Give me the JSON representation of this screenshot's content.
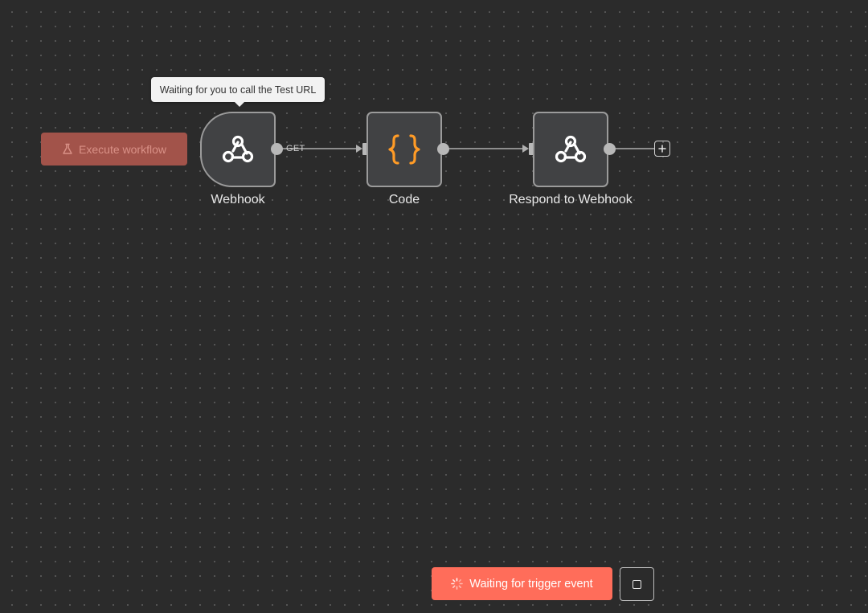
{
  "toolbar": {
    "execute_label": "Execute workflow"
  },
  "tooltip": {
    "text": "Waiting for you to call the Test URL"
  },
  "nodes": [
    {
      "id": "webhook",
      "label": "Webhook",
      "icon": "webhook-icon"
    },
    {
      "id": "code",
      "label": "Code",
      "icon": "code-braces-icon"
    },
    {
      "id": "respond",
      "label": "Respond to Webhook",
      "icon": "webhook-icon"
    }
  ],
  "connections": [
    {
      "from": "webhook",
      "to": "code",
      "label": "GET"
    },
    {
      "from": "code",
      "to": "respond",
      "label": ""
    }
  ],
  "footer": {
    "waiting_label": "Waiting for trigger event"
  },
  "colors": {
    "canvas": "#2b2b2b",
    "accent": "#ff6d5a",
    "code_icon": "#ff9b26",
    "node_bg": "#414244"
  }
}
